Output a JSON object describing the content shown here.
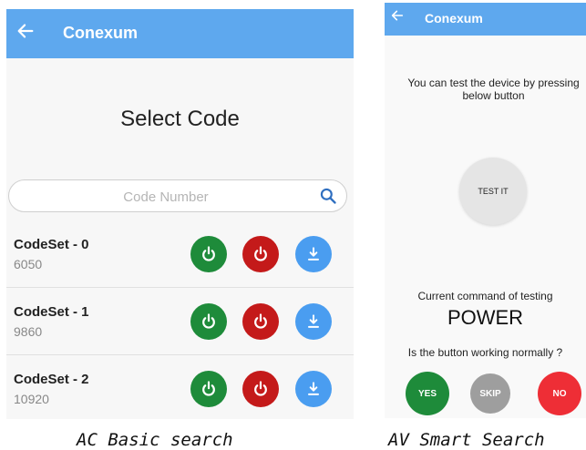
{
  "left_screen": {
    "app_title": "Conexum",
    "heading": "Select Code",
    "search": {
      "placeholder": "Code Number",
      "value": ""
    },
    "codesets": [
      {
        "name": "CodeSet - 0",
        "code": "6050"
      },
      {
        "name": "CodeSet - 1",
        "code": "9860"
      },
      {
        "name": "CodeSet - 2",
        "code": "10920"
      }
    ],
    "icons": {
      "back": "arrow-left-icon",
      "search": "search-icon",
      "on": "power-icon",
      "off": "power-icon",
      "download": "download-icon"
    },
    "colors": {
      "appbar": "#5ea8ee",
      "on_button": "#1e8b3a",
      "off_button": "#c41a1a",
      "download_button": "#4a9df0"
    },
    "caption": "AC Basic search"
  },
  "right_screen": {
    "app_title": "Conexum",
    "hint_line1": "You can test the device by pressing",
    "hint_line2": "below button",
    "test_button": "TEST IT",
    "command_label": "Current command of testing",
    "command_value": "POWER",
    "question": "Is the button working normally ?",
    "yes_button": "YES",
    "skip_button": "SKIP",
    "no_button": "NO",
    "colors": {
      "yes": "#1e8b3a",
      "skip": "#9e9e9e",
      "no": "#ee2e36"
    },
    "caption": "AV Smart Search"
  }
}
